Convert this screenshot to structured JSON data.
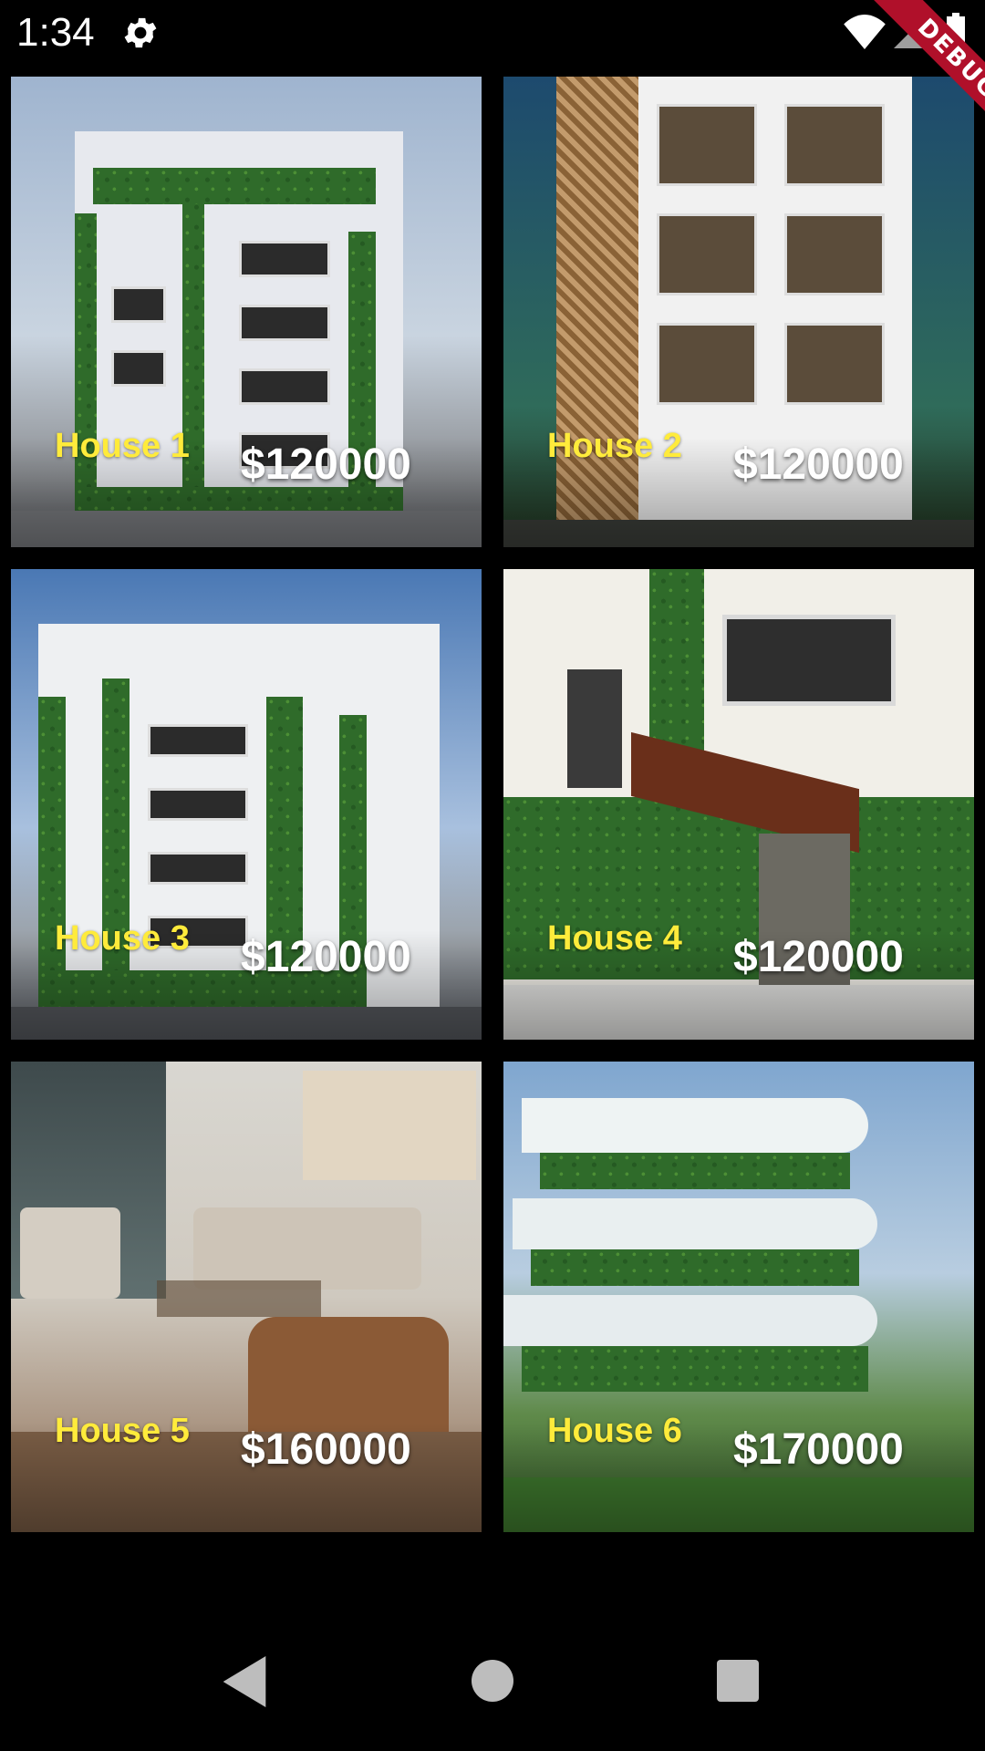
{
  "status_bar": {
    "time": "1:34",
    "icons": [
      "settings-gear-icon",
      "wifi-icon",
      "cell-signal-icon",
      "battery-icon"
    ]
  },
  "debug_banner": "DEBUG",
  "houses": [
    {
      "name": "House 1",
      "price": "$120000"
    },
    {
      "name": "House 2",
      "price": "$120000"
    },
    {
      "name": "House 3",
      "price": "$120000"
    },
    {
      "name": "House 4",
      "price": "$120000"
    },
    {
      "name": "House 5",
      "price": "$160000"
    },
    {
      "name": "House 6",
      "price": "$170000"
    }
  ],
  "colors": {
    "name_text": "#FFEB3B",
    "price_text": "#FFFFFF",
    "background": "#000000"
  },
  "nav_bar": {
    "icons": [
      "back-icon",
      "home-icon",
      "recents-icon"
    ]
  }
}
